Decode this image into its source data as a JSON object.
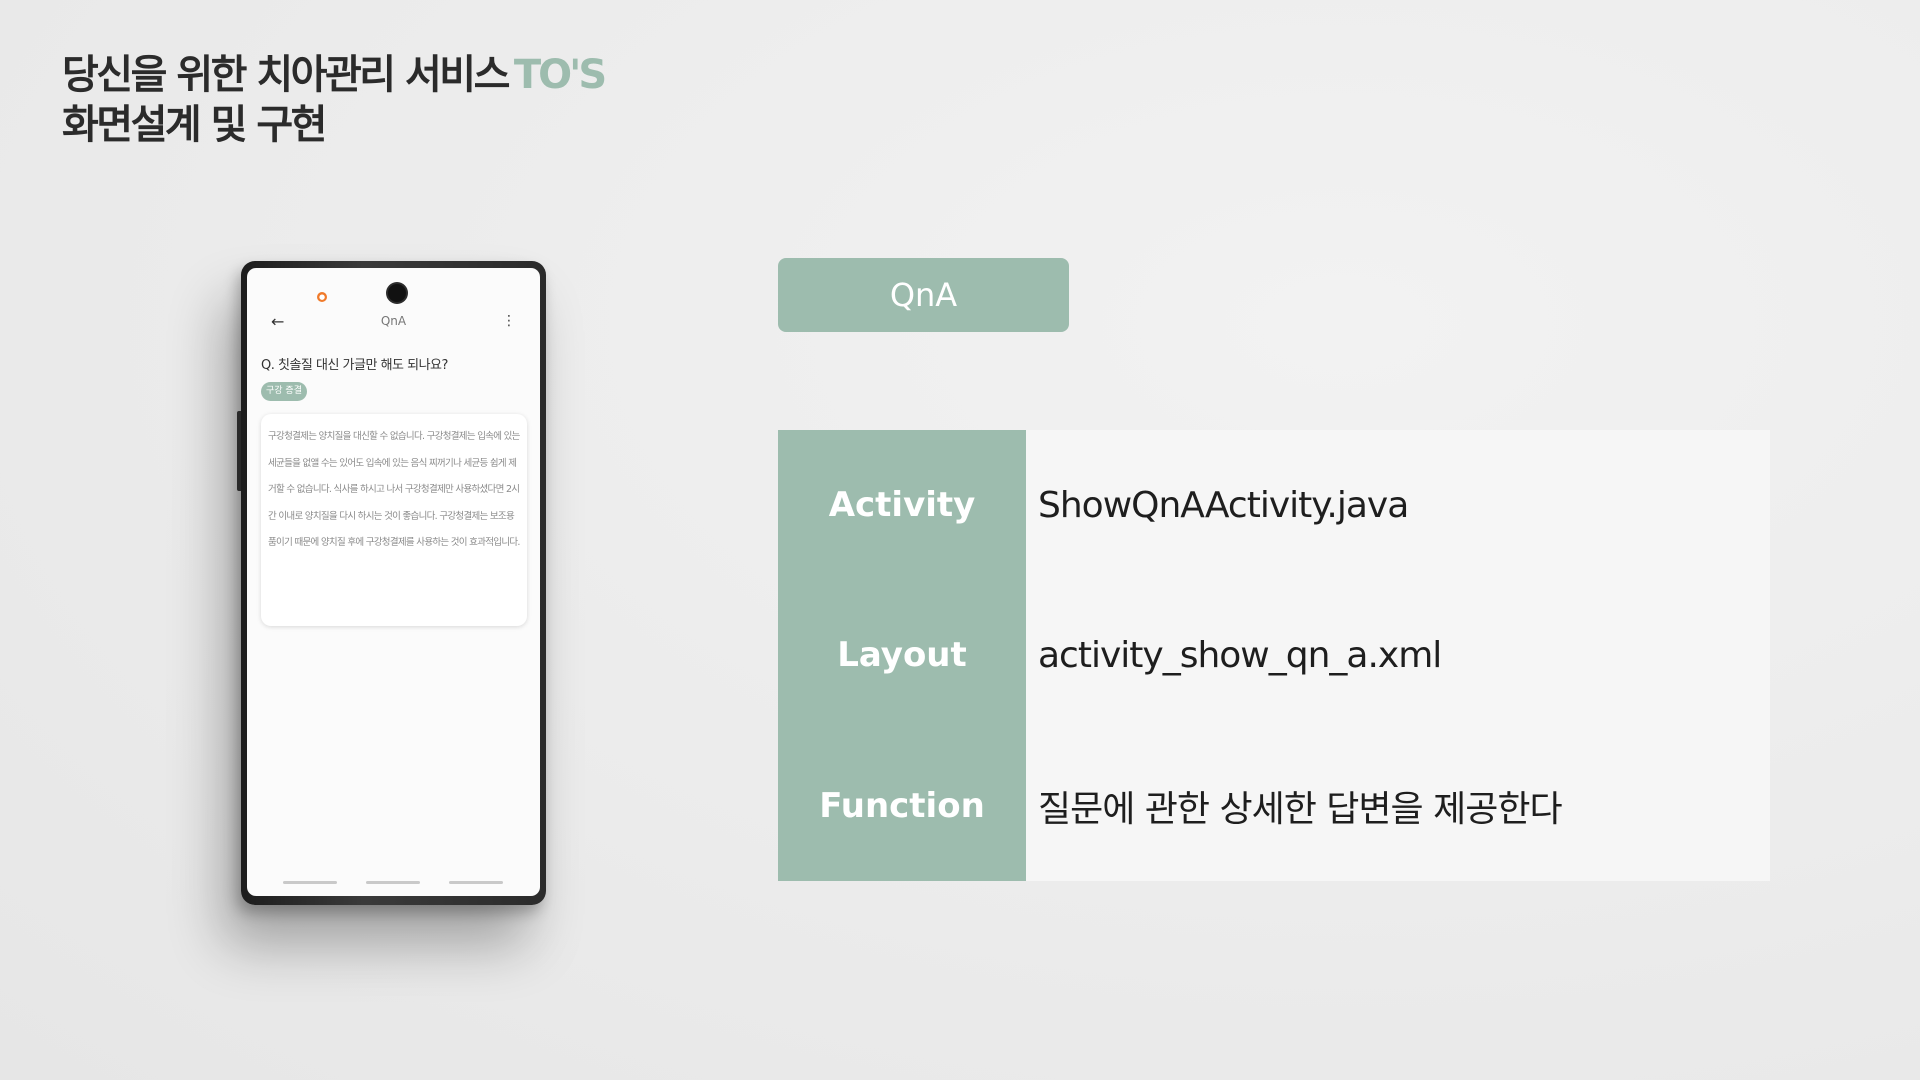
{
  "header": {
    "title_main": "당신을 위한 치아관리 서비스",
    "title_brand": "TO'S",
    "subtitle": "화면설계 및 구현"
  },
  "phone": {
    "status_indicator": "●",
    "appbar": {
      "back_icon": "←",
      "title": "QnA",
      "more_icon": "⋮"
    },
    "question": "Q. 칫솔질 대신 가글만 해도 되나요?",
    "tag": "구강 증결",
    "answer": "구강청결제는 양치질을 대신할 수 없습니다. 구강청결제는 입속에 있는 세균들을 없앨 수는 있어도 입속에 있는 음식 찌꺼기나 세균등 쉽게 제거할 수 없습니다. 식사를 하시고 나서 구강청결제만 사용하셨다면 2시간 이내로 양치질을 다시 하시는 것이 좋습니다. 구강청결제는 보조용품이기 때문에 양치질 후에 구강청결제를 사용하는 것이 효과적입니다."
  },
  "panel": {
    "screen_name": "QnA",
    "rows": [
      {
        "key": "Activity",
        "value": "ShowQnAActivity.java"
      },
      {
        "key": "Layout",
        "value": "activity_show_qn_a.xml"
      },
      {
        "key": "Function",
        "value": "질문에 관한 상세한 답변을 제공한다"
      }
    ]
  },
  "colors": {
    "accent": "#9dbcae",
    "table_value_bg": "#f6f6f6",
    "title_text": "#2b2b2b",
    "status_dot": "#f07a2a"
  }
}
